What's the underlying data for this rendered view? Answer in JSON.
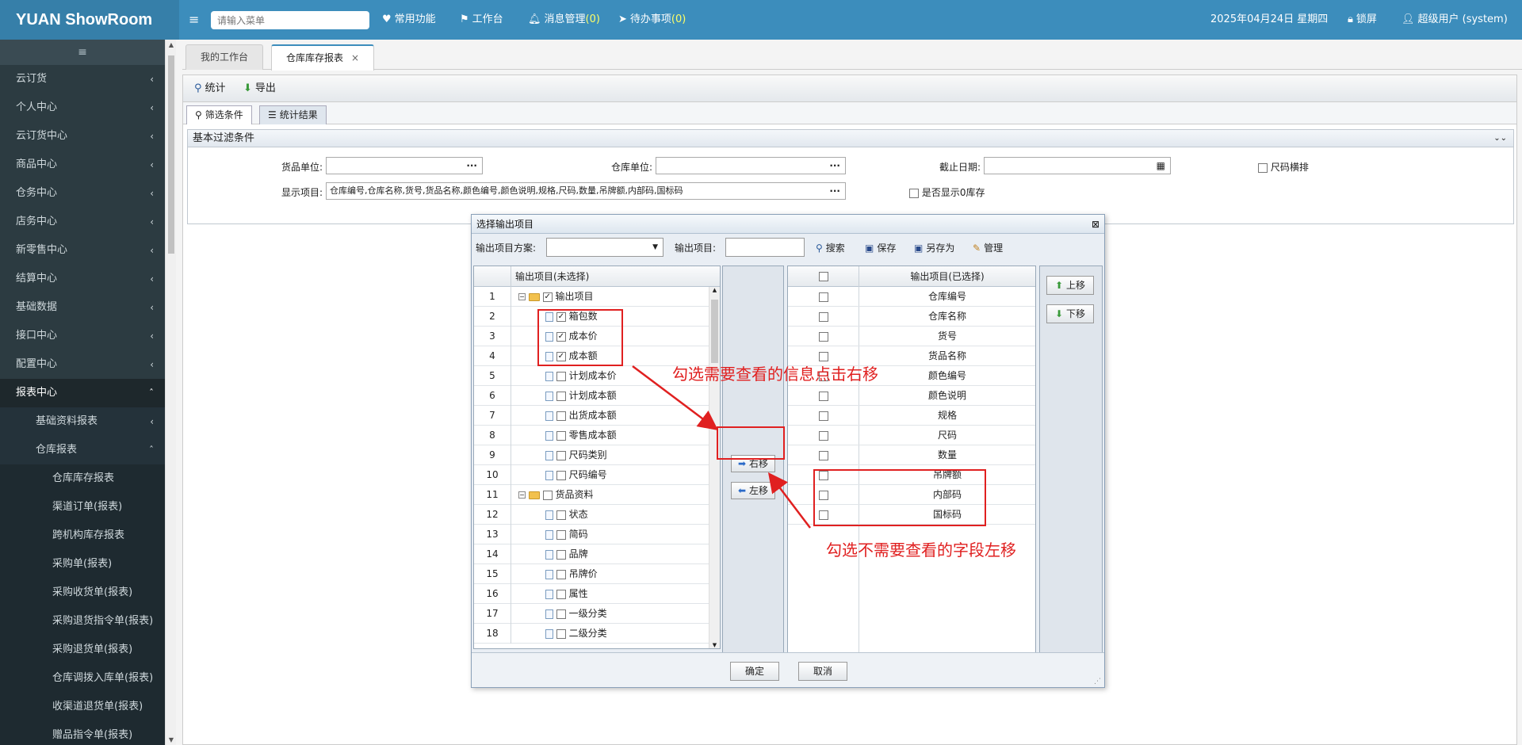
{
  "app": {
    "brand": "YUAN ShowRoom",
    "search_placeholder": "请输入菜单"
  },
  "topnav": {
    "common": "常用功能",
    "workbench": "工作台",
    "messages": "消息管理",
    "messages_count": "(0)",
    "todos": "待办事项",
    "todos_count": "(0)",
    "date": "2025年04月24日 星期四",
    "lock": "锁屏",
    "user": "超级用户 (system)"
  },
  "sidebar": {
    "toggle_icon": "≡",
    "items": [
      {
        "label": "云订货",
        "level": 0,
        "chev": "‹"
      },
      {
        "label": "个人中心",
        "level": 0,
        "chev": "‹"
      },
      {
        "label": "云订货中心",
        "level": 0,
        "chev": "‹"
      },
      {
        "label": "商品中心",
        "level": 0,
        "chev": "‹"
      },
      {
        "label": "仓务中心",
        "level": 0,
        "chev": "‹"
      },
      {
        "label": "店务中心",
        "level": 0,
        "chev": "‹"
      },
      {
        "label": "新零售中心",
        "level": 0,
        "chev": "‹"
      },
      {
        "label": "结算中心",
        "level": 0,
        "chev": "‹"
      },
      {
        "label": "基础数据",
        "level": 0,
        "chev": "‹"
      },
      {
        "label": "接口中心",
        "level": 0,
        "chev": "‹"
      },
      {
        "label": "配置中心",
        "level": 0,
        "chev": "‹"
      },
      {
        "label": "报表中心",
        "level": 0,
        "chev": "ˆ"
      },
      {
        "label": "基础资料报表",
        "level": 1,
        "chev": "‹"
      },
      {
        "label": "仓库报表",
        "level": 1,
        "chev": "ˆ"
      },
      {
        "label": "仓库库存报表",
        "level": 2,
        "chev": ""
      },
      {
        "label": "渠道订单(报表)",
        "level": 2,
        "chev": ""
      },
      {
        "label": "跨机构库存报表",
        "level": 2,
        "chev": ""
      },
      {
        "label": "采购单(报表)",
        "level": 2,
        "chev": ""
      },
      {
        "label": "采购收货单(报表)",
        "level": 2,
        "chev": ""
      },
      {
        "label": "采购退货指令单(报表)",
        "level": 2,
        "chev": ""
      },
      {
        "label": "采购退货单(报表)",
        "level": 2,
        "chev": ""
      },
      {
        "label": "仓库调拨入库单(报表)",
        "level": 2,
        "chev": ""
      },
      {
        "label": "收渠道退货单(报表)",
        "level": 2,
        "chev": ""
      },
      {
        "label": "赠品指令单(报表)",
        "level": 2,
        "chev": ""
      }
    ]
  },
  "tabs": [
    {
      "label": "我的工作台",
      "active": false
    },
    {
      "label": "仓库库存报表",
      "active": true,
      "close": "×"
    }
  ],
  "toolbar": {
    "stat": "统计",
    "export": "导出"
  },
  "subtabs": {
    "filter": "筛选条件",
    "result": "统计结果"
  },
  "filter": {
    "header": "基本过滤条件",
    "goods_unit_label": "货品单位:",
    "warehouse_unit_label": "仓库单位:",
    "deadline_label": "截止日期:",
    "size_horizontal": "尺码横排",
    "display_items_label": "显示项目:",
    "display_items_value": "仓库编号,仓库名称,货号,货品名称,颜色编号,颜色说明,规格,尺码,数量,吊牌额,内部码,国标码",
    "show_zero_stock": "是否显示0库存",
    "dots": "···"
  },
  "dialog": {
    "title": "选择输出项目",
    "close": "⊠",
    "scheme_label": "输出项目方案:",
    "item_label": "输出项目:",
    "search": "搜索",
    "save": "保存",
    "save_as": "另存为",
    "manage": "管理",
    "left_header": "输出项目(未选择)",
    "right_header": "输出项目(已选择)",
    "move_right": "右移",
    "move_left": "左移",
    "move_up": "上移",
    "move_down": "下移",
    "ok": "确定",
    "cancel": "取消",
    "left_rows": [
      {
        "n": "1",
        "label": "输出项目",
        "type": "folder",
        "checked": true
      },
      {
        "n": "2",
        "label": "箱包数",
        "type": "doc",
        "checked": true
      },
      {
        "n": "3",
        "label": "成本价",
        "type": "doc",
        "checked": true
      },
      {
        "n": "4",
        "label": "成本额",
        "type": "doc",
        "checked": true
      },
      {
        "n": "5",
        "label": "计划成本价",
        "type": "doc",
        "checked": false
      },
      {
        "n": "6",
        "label": "计划成本额",
        "type": "doc",
        "checked": false
      },
      {
        "n": "7",
        "label": "出货成本额",
        "type": "doc",
        "checked": false
      },
      {
        "n": "8",
        "label": "零售成本额",
        "type": "doc",
        "checked": false
      },
      {
        "n": "9",
        "label": "尺码类别",
        "type": "doc",
        "checked": false
      },
      {
        "n": "10",
        "label": "尺码编号",
        "type": "doc",
        "checked": false
      },
      {
        "n": "11",
        "label": "货品资料",
        "type": "folder",
        "checked": false
      },
      {
        "n": "12",
        "label": "状态",
        "type": "doc",
        "checked": false
      },
      {
        "n": "13",
        "label": "简码",
        "type": "doc",
        "checked": false
      },
      {
        "n": "14",
        "label": "品牌",
        "type": "doc",
        "checked": false
      },
      {
        "n": "15",
        "label": "吊牌价",
        "type": "doc",
        "checked": false
      },
      {
        "n": "16",
        "label": "属性",
        "type": "doc",
        "checked": false
      },
      {
        "n": "17",
        "label": "一级分类",
        "type": "doc",
        "checked": false
      },
      {
        "n": "18",
        "label": "二级分类",
        "type": "doc",
        "checked": false
      }
    ],
    "right_rows": [
      "仓库编号",
      "仓库名称",
      "货号",
      "货品名称",
      "颜色编号",
      "颜色说明",
      "规格",
      "尺码",
      "数量",
      "吊牌额",
      "内部码",
      "国标码"
    ]
  },
  "annotations": {
    "right_hint": "勾选需要查看的信息点击右移",
    "left_hint": "勾选不需要查看的字段左移",
    "color": "#e02020"
  }
}
